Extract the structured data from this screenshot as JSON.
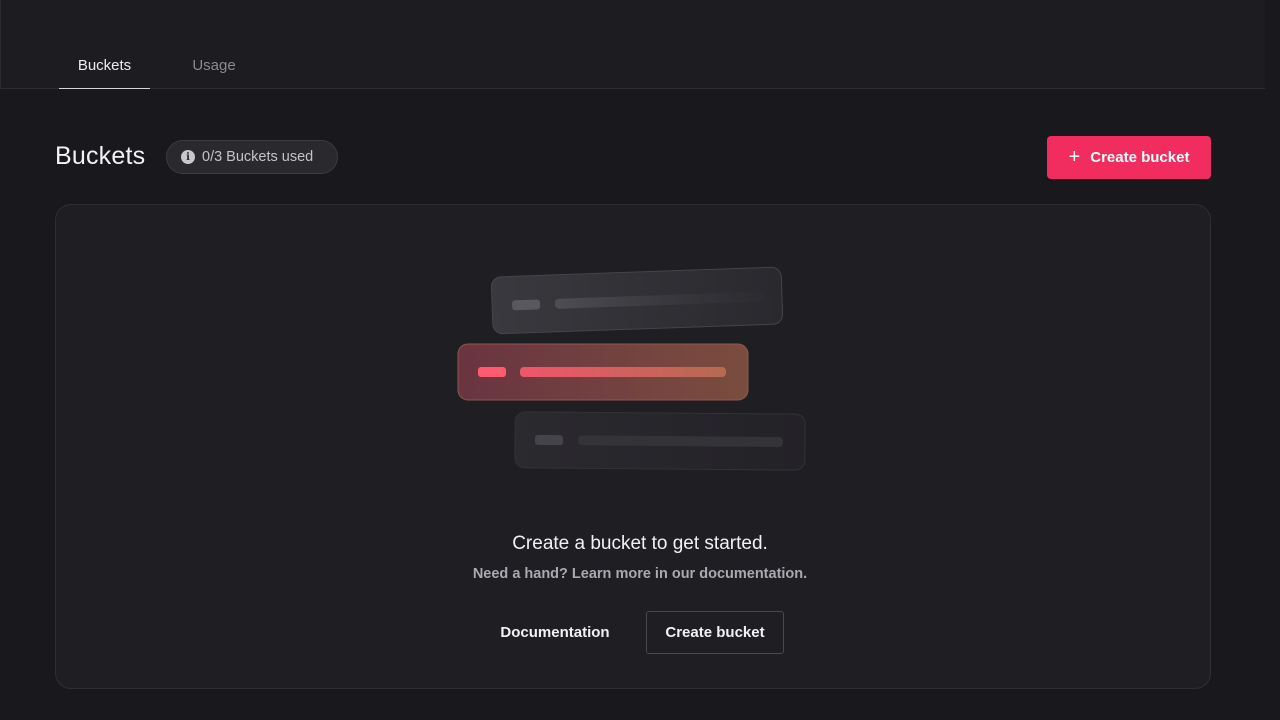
{
  "tabs": [
    {
      "label": "Buckets",
      "active": true
    },
    {
      "label": "Usage",
      "active": false
    }
  ],
  "page": {
    "title": "Buckets",
    "usage_badge": "0/3 Buckets used",
    "create_button": "Create bucket"
  },
  "empty_state": {
    "title": "Create a bucket to get started.",
    "subtitle": "Need a hand? Learn more in our documentation.",
    "documentation_button": "Documentation",
    "create_button": "Create bucket"
  },
  "colors": {
    "accent": "#f02d5e",
    "background": "#19181c",
    "card": "#1f1e23"
  },
  "icons": {
    "badge_icon": "info-icon",
    "create_icon": "plus-icon"
  }
}
